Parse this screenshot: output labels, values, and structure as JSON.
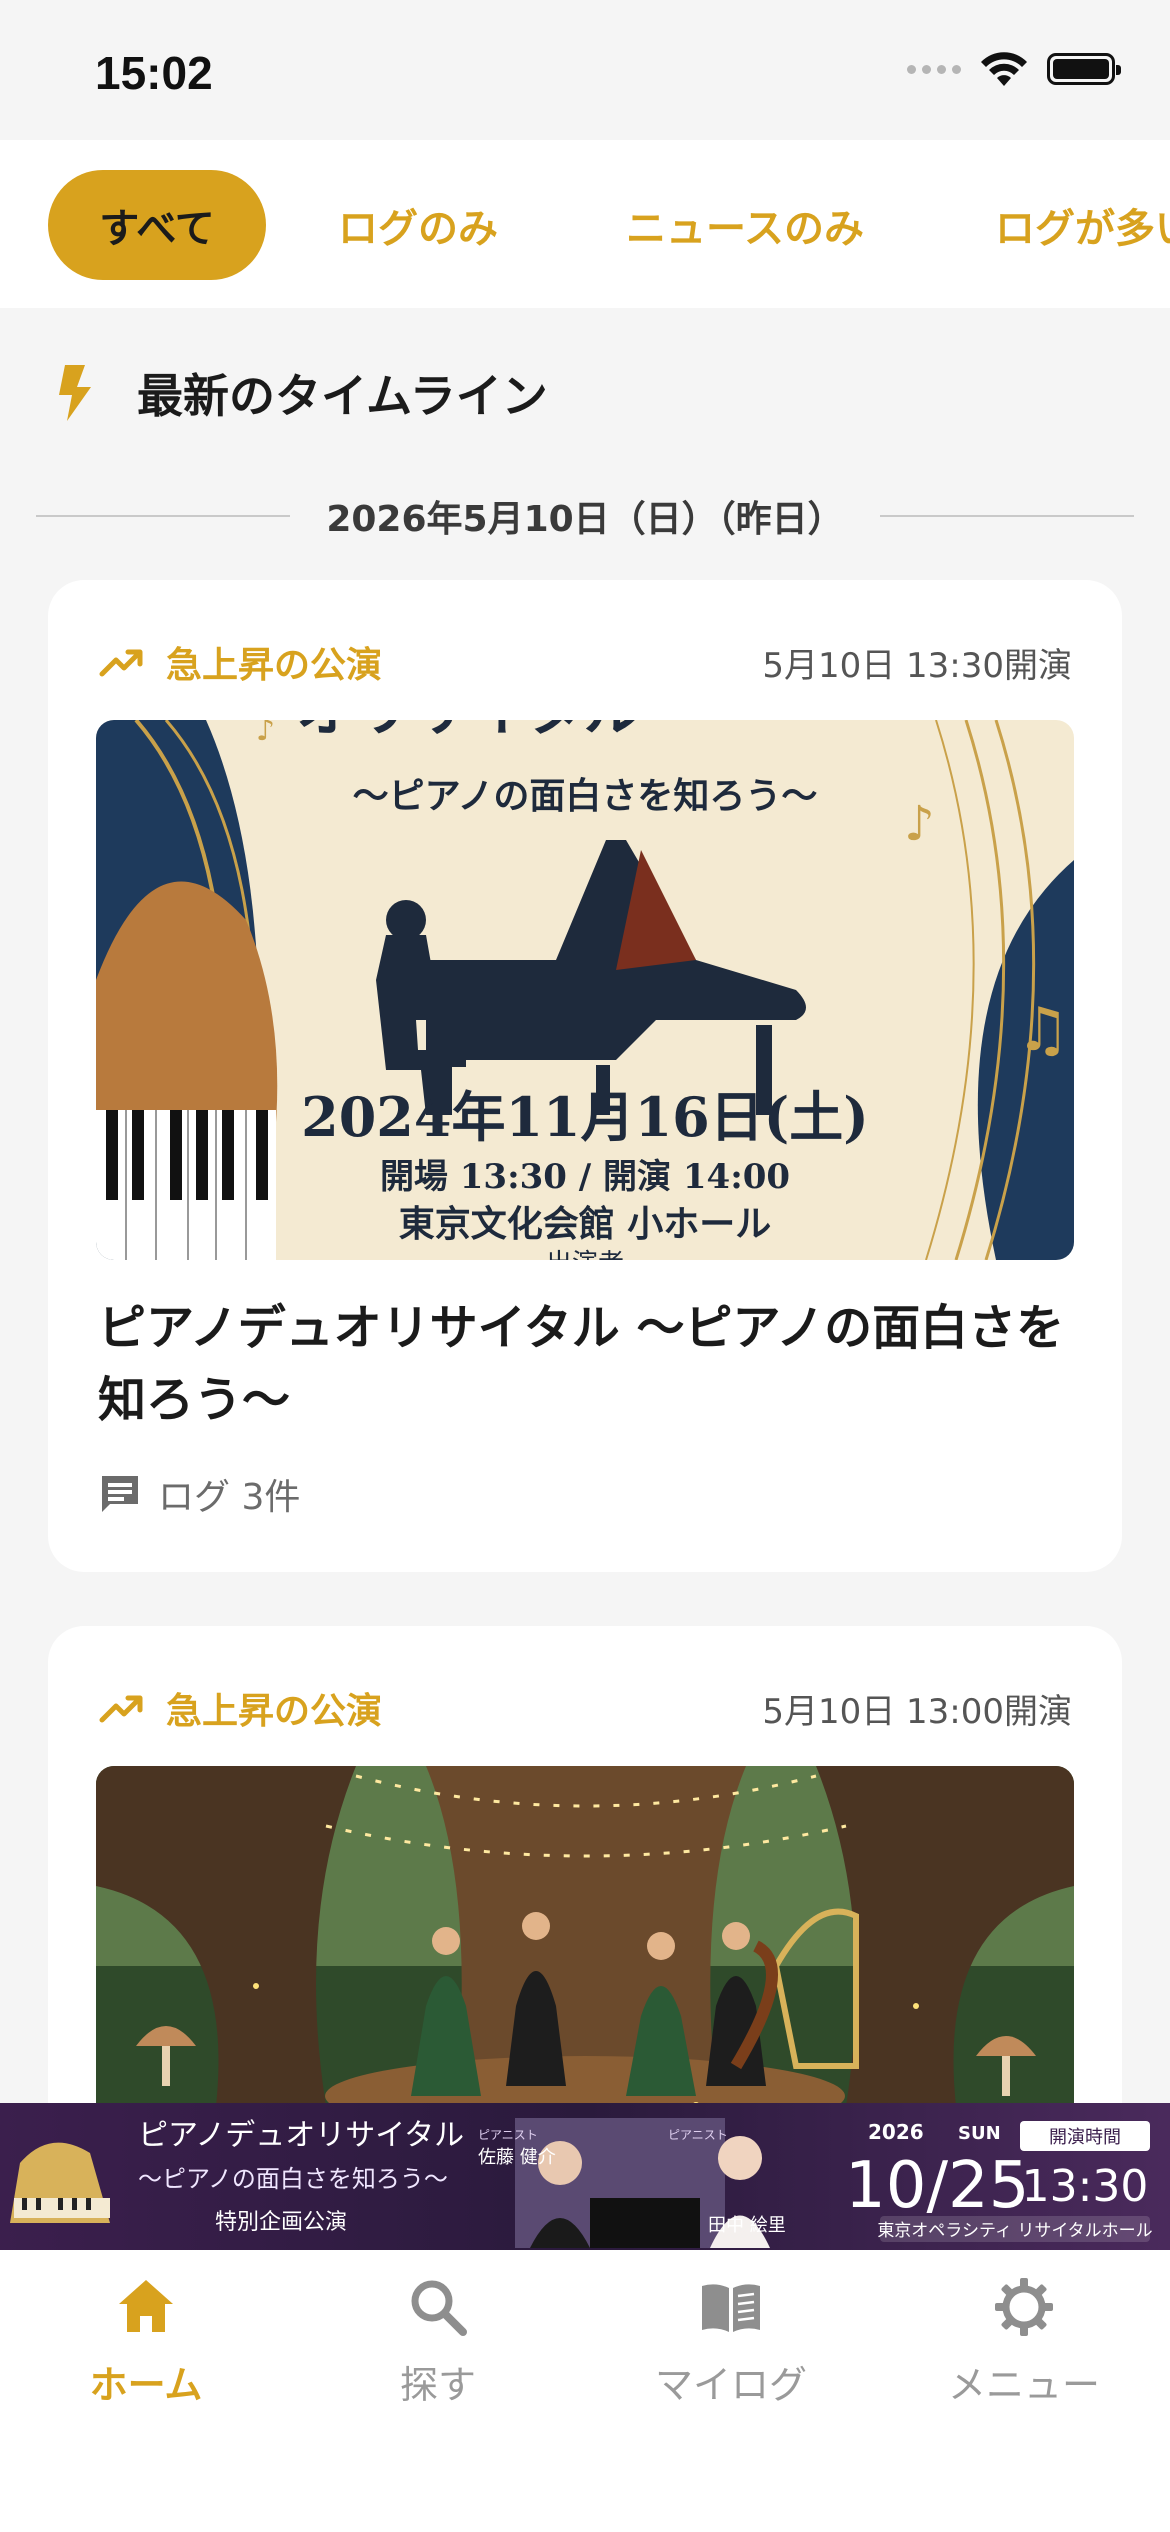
{
  "status_bar": {
    "time": "15:02"
  },
  "filters": [
    {
      "label": "すべて",
      "active": true
    },
    {
      "label": "ログのみ",
      "active": false
    },
    {
      "label": "ニュースのみ",
      "active": false
    },
    {
      "label": "ログが多い",
      "active": false
    }
  ],
  "section": {
    "title": "最新のタイムライン",
    "icon": "bolt-icon"
  },
  "date_divider": "2026年5月10日（日）（昨日）",
  "cards": [
    {
      "badge": "急上昇の公演",
      "time": "5月10日 13:30開演",
      "title": "ピアノデュオリサイタル 〜ピアノの面白さを知ろう〜",
      "log_count": "ログ 3件",
      "poster": {
        "heading": "オリサイタル",
        "subtitle": "〜ピアノの面白さを知ろう〜",
        "date": "2024年11月16日(土)",
        "times": "開場 13:30 / 開演 14:00",
        "venue": "東京文化会館 小ホール",
        "footer": "出演者"
      }
    },
    {
      "badge": "急上昇の公演",
      "time": "5月10日 13:00開演",
      "image_alt": "forest-string-quartet-illustration"
    }
  ],
  "ad": {
    "title": "ピアノデュオリサイタル",
    "subtitle": "〜ピアノの面白さを知ろう〜",
    "tag": "特別企画公演",
    "performer1_role": "ピアニスト",
    "performer1": "佐藤 健介",
    "performer2_role": "ピアニスト",
    "performer2": "田中 絵里",
    "year": "2026",
    "weekday": "SUN",
    "date": "10/25",
    "time_label": "開演時間",
    "time": "13:30",
    "venue": "東京オペラシティ リサイタルホール"
  },
  "tabs": [
    {
      "label": "ホーム",
      "icon": "home-icon",
      "active": true
    },
    {
      "label": "探す",
      "icon": "search-icon",
      "active": false
    },
    {
      "label": "マイログ",
      "icon": "book-icon",
      "active": false
    },
    {
      "label": "メニュー",
      "icon": "gear-icon",
      "active": false
    }
  ],
  "colors": {
    "accent": "#d8a21e",
    "text": "#1b1b1b",
    "muted": "#6b6b6b",
    "background": "#f5f5f5"
  }
}
